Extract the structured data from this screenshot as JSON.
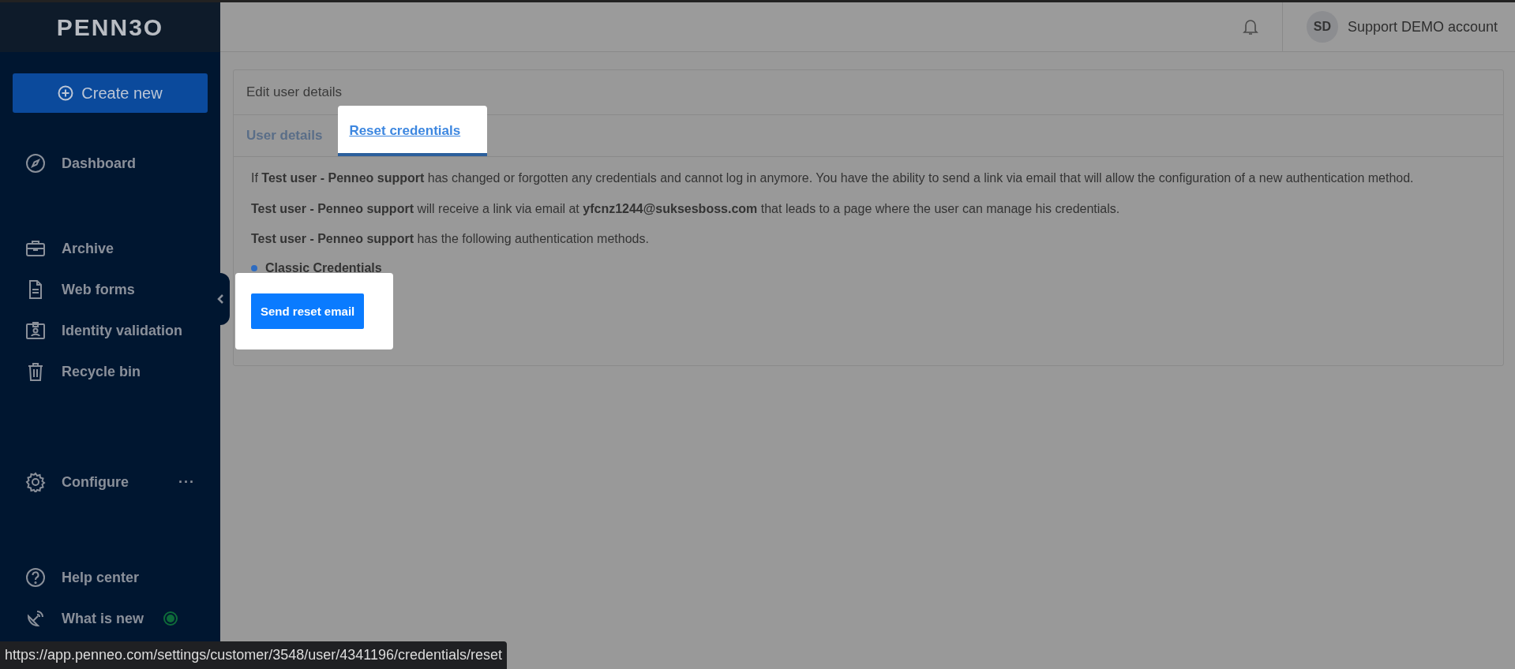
{
  "sidebar": {
    "logo": "PENN3O",
    "create_button": "Create new",
    "items": [
      {
        "label": "Dashboard"
      },
      {
        "label": "Archive"
      },
      {
        "label": "Web forms"
      },
      {
        "label": "Identity validation"
      },
      {
        "label": "Recycle bin"
      },
      {
        "label": "Configure",
        "more": "···"
      },
      {
        "label": "Help center"
      },
      {
        "label": "What is new"
      }
    ]
  },
  "topbar": {
    "avatar": "SD",
    "account": "Support DEMO account"
  },
  "card": {
    "title": "Edit user details",
    "tabs": [
      {
        "label": "User details",
        "selected": false
      },
      {
        "label": "Reset credentials",
        "selected": true
      }
    ],
    "paragraphs": [
      "If **Test user - Penneo support** has changed or forgotten any credentials and cannot log in anymore. You have the ability to send a link via email that will allow the configuration of a new authentication method.",
      "**Test user - Penneo support** will receive a link via email at **yfcnz1244@suksesboss.com** that leads to a page where the user can manage his credentials.",
      "**Test user - Penneo support** has the following authentication methods."
    ],
    "methods": [
      "Classic Credentials"
    ],
    "button": "Send reset email"
  },
  "status_url": "https://app.penneo.com/settings/customer/3548/user/4341196/credentials/reset"
}
